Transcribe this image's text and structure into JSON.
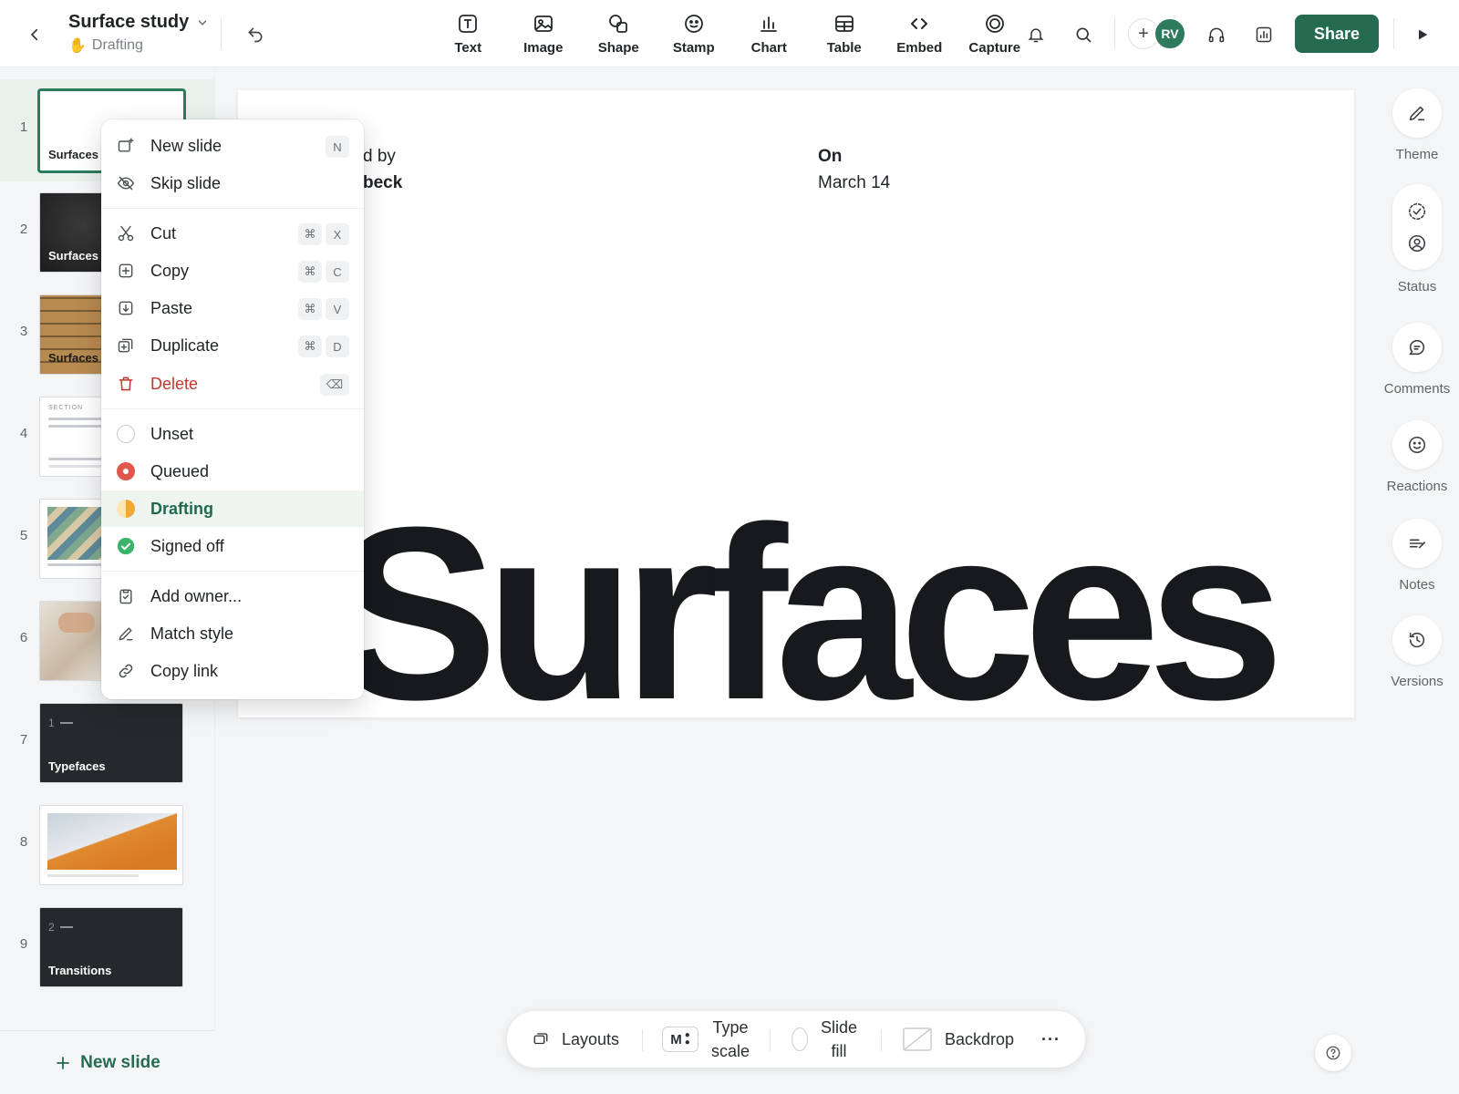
{
  "header": {
    "doc_title": "Surface study",
    "doc_status": "Drafting",
    "tools": [
      {
        "label": "Text",
        "icon": "text-icon"
      },
      {
        "label": "Image",
        "icon": "image-icon"
      },
      {
        "label": "Shape",
        "icon": "shape-icon"
      },
      {
        "label": "Stamp",
        "icon": "stamp-icon"
      },
      {
        "label": "Chart",
        "icon": "chart-icon"
      },
      {
        "label": "Table",
        "icon": "table-icon"
      },
      {
        "label": "Embed",
        "icon": "embed-icon"
      },
      {
        "label": "Capture",
        "icon": "capture-icon"
      }
    ],
    "avatar_initials": "RV",
    "share_label": "Share"
  },
  "slides": [
    {
      "num": "1",
      "label": "Surfaces"
    },
    {
      "num": "2",
      "label": "Surfaces"
    },
    {
      "num": "3",
      "label": "Surfaces"
    },
    {
      "num": "4",
      "label": "SECTION"
    },
    {
      "num": "5",
      "label": ""
    },
    {
      "num": "6",
      "label": ""
    },
    {
      "num": "7",
      "label": "Typefaces",
      "section_num": "1"
    },
    {
      "num": "8",
      "label": ""
    },
    {
      "num": "9",
      "label": "Transitions",
      "section_num": "2"
    }
  ],
  "new_slide_label": "New slide",
  "canvas": {
    "byline_prefix": "d by",
    "byline_name": "beck",
    "on_label": "On",
    "on_date": "March 14",
    "big_title": "Surfaces"
  },
  "context_menu": {
    "new_slide": {
      "label": "New slide",
      "key": "N"
    },
    "skip_slide": {
      "label": "Skip slide"
    },
    "cut": {
      "label": "Cut",
      "mod": "⌘",
      "key": "X"
    },
    "copy": {
      "label": "Copy",
      "mod": "⌘",
      "key": "C"
    },
    "paste": {
      "label": "Paste",
      "mod": "⌘",
      "key": "V"
    },
    "duplicate": {
      "label": "Duplicate",
      "mod": "⌘",
      "key": "D"
    },
    "delete": {
      "label": "Delete",
      "key": "⌫"
    },
    "status_unset": {
      "label": "Unset"
    },
    "status_queued": {
      "label": "Queued"
    },
    "status_drafting": {
      "label": "Drafting"
    },
    "status_signed_off": {
      "label": "Signed off"
    },
    "add_owner": {
      "label": "Add owner..."
    },
    "match_style": {
      "label": "Match style"
    },
    "copy_link": {
      "label": "Copy link"
    }
  },
  "rail": {
    "theme": "Theme",
    "status": "Status",
    "comments": "Comments",
    "reactions": "Reactions",
    "notes": "Notes",
    "versions": "Versions"
  },
  "bottombar": {
    "layouts": "Layouts",
    "type_scale_chip": "M",
    "type_scale_1": "Type",
    "type_scale_2": "scale",
    "slide_fill_1": "Slide",
    "slide_fill_2": "fill",
    "backdrop": "Backdrop",
    "more": "···"
  },
  "colors": {
    "accent": "#256b51",
    "queued": "#e2574c",
    "drafting": "#f0a92e",
    "signed_off": "#3bb36b",
    "danger": "#c0392b"
  }
}
